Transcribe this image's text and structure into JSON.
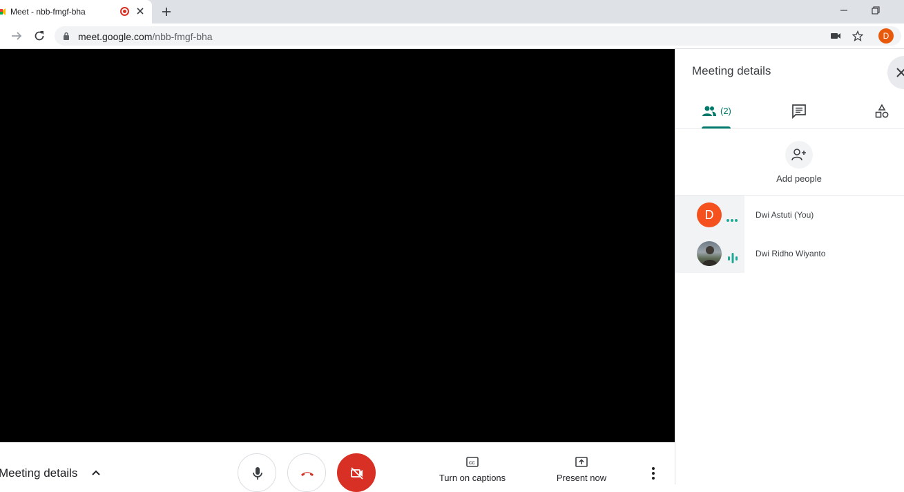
{
  "browser": {
    "tab_title": "Meet - nbb-fmgf-bha",
    "url_host": "meet.google.com",
    "url_path": "/nbb-fmgf-bha",
    "profile_initial": "D"
  },
  "meeting": {
    "bottom_toggle_label": "Meeting details",
    "captions_label": "Turn on captions",
    "present_label": "Present now"
  },
  "panel": {
    "title": "Meeting details",
    "people_count": "(2)",
    "add_people_label": "Add people",
    "participants": [
      {
        "name": "Dwi Astuti (You)",
        "avatar_letter": "D",
        "avatar_color": "#f4511e",
        "status": "more-dots"
      },
      {
        "name": "Dwi Ridho Wiyanto",
        "avatar_letter": "",
        "status": "speaking"
      }
    ]
  },
  "colors": {
    "accent": "#00796b",
    "danger": "#d93025",
    "speaking": "#1ea896"
  }
}
